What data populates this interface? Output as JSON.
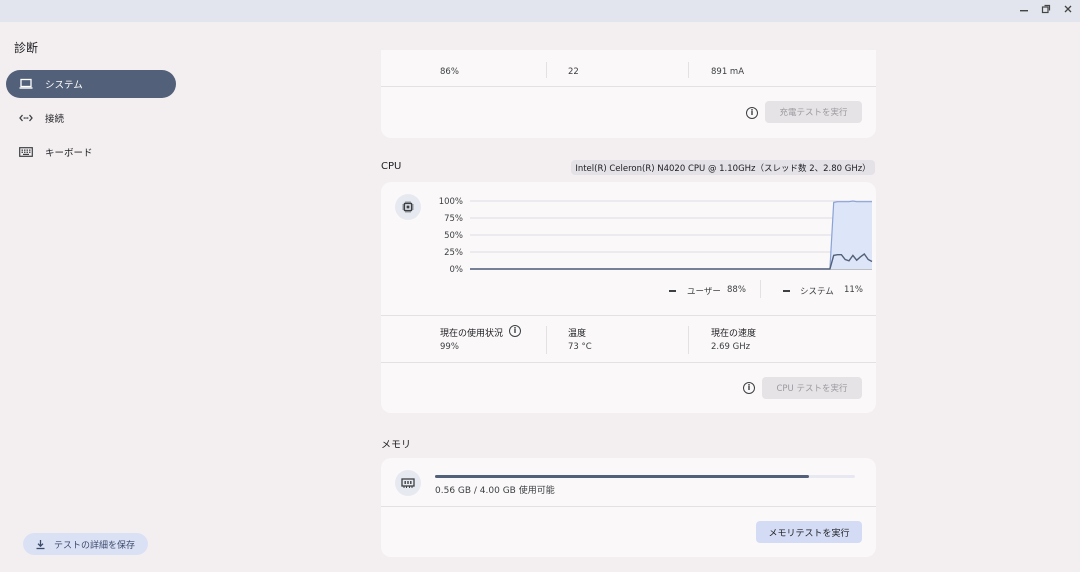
{
  "window": {
    "minimize_icon": "minimize-icon",
    "restore_icon": "restore-icon",
    "close_icon": "close-icon"
  },
  "app": {
    "title": "診断"
  },
  "sidebar": {
    "items": [
      {
        "label": "システム",
        "icon": "laptop-icon",
        "active": true
      },
      {
        "label": "接続",
        "icon": "connection-icon",
        "active": false
      },
      {
        "label": "キーボード",
        "icon": "keyboard-icon",
        "active": false
      }
    ],
    "save_button": "テストの詳細を保存"
  },
  "battery": {
    "values": [
      "86%",
      "22",
      "891 mA"
    ],
    "test_button": "充電テストを実行"
  },
  "cpu": {
    "title": "CPU",
    "model": "Intel(R) Celeron(R) N4020 CPU @ 1.10GHz（スレッド数 2、2.80 GHz）",
    "legend_user": "ユーザー",
    "legend_user_value": "88%",
    "legend_system": "システム",
    "legend_system_value": "11%",
    "usage_label": "現在の使用状況",
    "usage_value": "99%",
    "temp_label": "温度",
    "temp_value": "73 °C",
    "speed_label": "現在の速度",
    "speed_value": "2.69 GHz",
    "test_button": "CPU テストを実行"
  },
  "chart_data": {
    "type": "area",
    "yticks": [
      "100%",
      "75%",
      "50%",
      "25%",
      "0%"
    ],
    "ylim": [
      0,
      100
    ],
    "series": [
      {
        "name": "ユーザー",
        "values": [
          0,
          0,
          0,
          0,
          0,
          0,
          0,
          0,
          0,
          0,
          0,
          0,
          0,
          0,
          0,
          0,
          0,
          0,
          0,
          0,
          0,
          0,
          0,
          0,
          0,
          0,
          0,
          0,
          0,
          0,
          0,
          0,
          0,
          0,
          0,
          0,
          0,
          0,
          0,
          0,
          0,
          0,
          0,
          0,
          0,
          0,
          0,
          0,
          0,
          0,
          0,
          0,
          0,
          0,
          0,
          0,
          0,
          0,
          0,
          0,
          0,
          0,
          0,
          0,
          0,
          0,
          0,
          0,
          0,
          0,
          0,
          0,
          0,
          0,
          0,
          0,
          0,
          0,
          0,
          0,
          0,
          0,
          0,
          0,
          0,
          0,
          0,
          0,
          0,
          0,
          0,
          0,
          0,
          0,
          0,
          98,
          99,
          99,
          99,
          99,
          100,
          99,
          99,
          99,
          99,
          99
        ]
      },
      {
        "name": "システム",
        "values": [
          0,
          0,
          0,
          0,
          0,
          0,
          0,
          0,
          0,
          0,
          0,
          0,
          0,
          0,
          0,
          0,
          0,
          0,
          0,
          0,
          0,
          0,
          0,
          0,
          0,
          0,
          0,
          0,
          0,
          0,
          0,
          0,
          0,
          0,
          0,
          0,
          0,
          0,
          0,
          0,
          0,
          0,
          0,
          0,
          0,
          0,
          0,
          0,
          0,
          0,
          0,
          0,
          0,
          0,
          0,
          0,
          0,
          0,
          0,
          0,
          0,
          0,
          0,
          0,
          0,
          0,
          0,
          0,
          0,
          0,
          0,
          0,
          0,
          0,
          0,
          0,
          0,
          0,
          0,
          0,
          0,
          0,
          0,
          0,
          0,
          0,
          0,
          0,
          0,
          0,
          0,
          0,
          0,
          0,
          0,
          20,
          21,
          21,
          14,
          12,
          20,
          13,
          18,
          22,
          14,
          11
        ]
      }
    ],
    "colors": {
      "fill": "#dde5f8",
      "user_line": "#8aa2d6",
      "system_line": "#536079",
      "grid": "#dddde2"
    }
  },
  "memory": {
    "title": "メモリ",
    "used_fraction": 0.89,
    "summary": "0.56 GB / 4.00 GB 使用可能",
    "test_button": "メモリテストを実行"
  }
}
